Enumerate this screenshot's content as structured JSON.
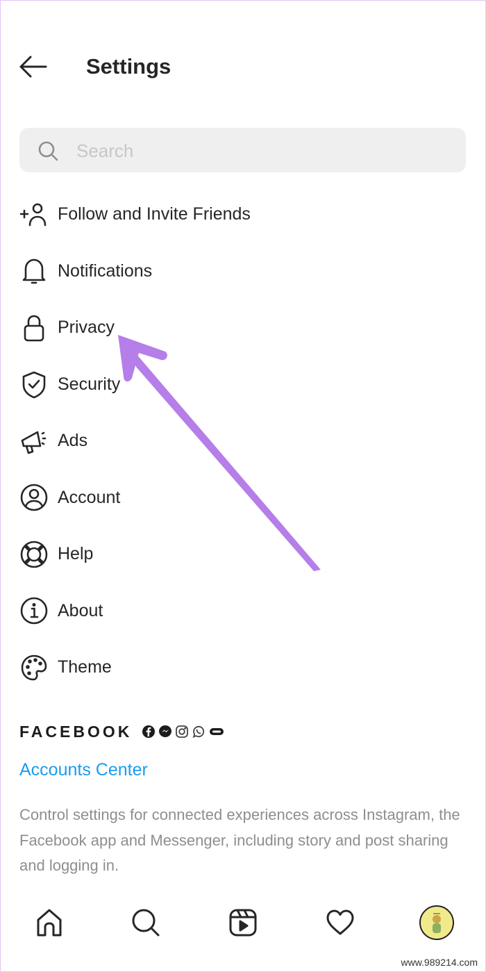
{
  "header": {
    "title": "Settings",
    "back_icon": "arrow-left-icon"
  },
  "search": {
    "placeholder": "Search",
    "value": "",
    "icon": "search-icon"
  },
  "menu": {
    "items": [
      {
        "label": "Follow and Invite Friends",
        "icon": "add-person-icon"
      },
      {
        "label": "Notifications",
        "icon": "bell-icon"
      },
      {
        "label": "Privacy",
        "icon": "lock-icon"
      },
      {
        "label": "Security",
        "icon": "shield-check-icon"
      },
      {
        "label": "Ads",
        "icon": "megaphone-icon"
      },
      {
        "label": "Account",
        "icon": "account-circle-icon"
      },
      {
        "label": "Help",
        "icon": "lifebuoy-icon"
      },
      {
        "label": "About",
        "icon": "info-icon"
      },
      {
        "label": "Theme",
        "icon": "palette-icon"
      }
    ]
  },
  "facebook": {
    "wordmark": "FACEBOOK",
    "app_icons": [
      "facebook-icon",
      "messenger-icon",
      "instagram-icon",
      "whatsapp-icon",
      "oculus-icon"
    ],
    "link": "Accounts Center",
    "description": "Control settings for connected experiences across Instagram, the Facebook app and Messenger, including story and post sharing and logging in."
  },
  "bottom_nav": {
    "items": [
      "home-icon",
      "search-icon",
      "reels-icon",
      "heart-icon",
      "profile-avatar"
    ]
  },
  "annotation": {
    "arrow_color": "#b57ee8",
    "points_to": "Privacy"
  },
  "watermark": "www.989214.com",
  "colors": {
    "link": "#1a9cf0",
    "text": "#262626",
    "muted": "#8e8e8e",
    "search_bg": "#efefef"
  }
}
